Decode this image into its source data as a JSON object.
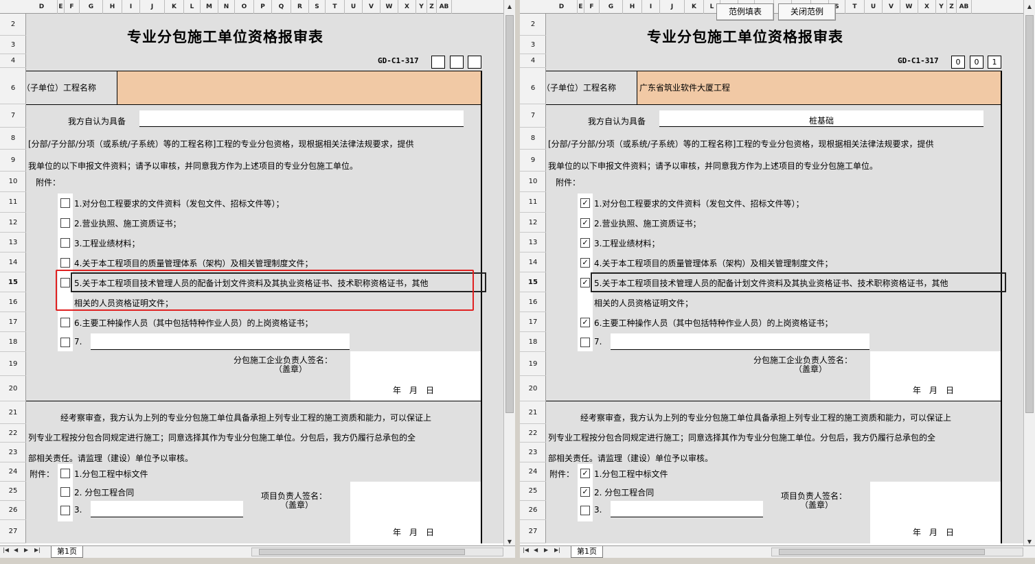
{
  "columns": [
    "D",
    "E",
    "F",
    "G",
    "H",
    "I",
    "J",
    "K",
    "L",
    "M",
    "N",
    "O",
    "P",
    "Q",
    "R",
    "S",
    "T",
    "U",
    "V",
    "W",
    "X",
    "Y",
    "Z",
    "AB"
  ],
  "rows": [
    "2",
    "3",
    "4",
    "6",
    "7",
    "8",
    "9",
    "10",
    "11",
    "12",
    "13",
    "14",
    "15",
    "16",
    "17",
    "18",
    "19",
    "20",
    "21",
    "22",
    "23",
    "24",
    "25",
    "26",
    "27"
  ],
  "selected_row": "15",
  "form": {
    "title": "专业分包施工单位资格报审表",
    "code_label": "GD-C1-317",
    "project_name_label": "（子单位）工程名称",
    "intro_prefix": "我方自认为具备",
    "line8": "[分部/子分部/分项（或系统/子系统）等的工程名称]工程的专业分包资格，现根据相关法律法规要求，提供",
    "line9": "我单位的以下申报文件资料；请予以审核，并同意我方作为上述项目的专业分包施工单位。",
    "attach_label": "附件：",
    "items": [
      "1.对分包工程要求的文件资料（发包文件、招标文件等）；",
      "2.营业执照、施工资质证书；",
      "3.工程业绩材料；",
      "4.关于本工程项目的质量管理体系（架构）及相关管理制度文件；",
      "5.关于本工程项目技术管理人员的配备计划文件资料及其执业资格证书、技术职称资格证书，其他",
      "6.主要工种操作人员（其中包括特种作业人员）的上岗资格证书；",
      "7."
    ],
    "item5_cont": "相关的人员资格证明文件；",
    "sign1_line1": "分包施工企业负责人签名：",
    "sign1_line2": "（盖章）",
    "date_label": "年　月　日",
    "review_line1": "经考察审查，我方认为上列的专业分包施工单位具备承担上列专业工程的施工资质和能力，可以保证上",
    "review_line2": "列专业工程按分包合同规定进行施工；同意选择其作为专业分包施工单位。分包后，我方仍履行总承包的全",
    "review_line3": "部相关责任。请监理（建设）单位予以审核。",
    "attach2_label": "附件：",
    "items2": [
      "1.分包工程中标文件",
      "2. 分包工程合同",
      "3."
    ],
    "sign2_line1": "项目负责人签名：",
    "sign2_line2": "（盖章）"
  },
  "left_pane": {
    "project_name": "",
    "qualification": "",
    "code_digits": [
      "",
      "",
      ""
    ],
    "item_checks": [
      false,
      false,
      false,
      false,
      false,
      false,
      false
    ],
    "items2_checks": [
      false,
      false,
      false
    ]
  },
  "right_pane": {
    "project_name": "广东省筑业软件大厦工程",
    "qualification": "桩基础",
    "code_digits": [
      "0",
      "0",
      "1"
    ],
    "item_checks": [
      true,
      true,
      true,
      true,
      true,
      true,
      false
    ],
    "items2_checks": [
      true,
      true,
      false
    ]
  },
  "buttons": {
    "example_fill": "范例填表",
    "close_example": "关闭范例"
  },
  "sheet_tab": "第1页",
  "colors": {
    "name_fill": "#f1c9a5",
    "sheet_bg": "#e0e0e0",
    "highlight": "#e02020"
  }
}
